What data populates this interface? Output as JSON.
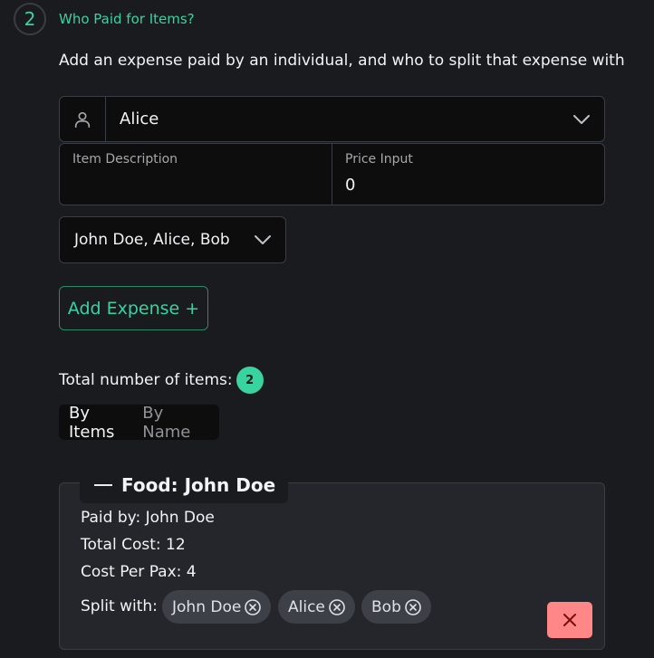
{
  "step": {
    "number": "2",
    "title": "Who Paid for Items?",
    "subtitle": "Add an expense paid by an individual, and who to split that expense with"
  },
  "form": {
    "payer": {
      "icon": "user-icon",
      "value": "Alice"
    },
    "item_description": {
      "label": "Item Description",
      "value": ""
    },
    "price_input": {
      "label": "Price Input",
      "value": "0"
    },
    "split_with": {
      "value": "John Doe, Alice, Bob"
    },
    "add_button": "Add Expense +"
  },
  "summary": {
    "total_label": "Total number of items:",
    "total_count": "2",
    "tabs": [
      {
        "label": "By Items",
        "active": true
      },
      {
        "label": "By Name",
        "active": false
      }
    ]
  },
  "expense_card": {
    "legend": "Food: John Doe",
    "paid_by": "Paid by: John Doe",
    "total_cost": "Total Cost: 12",
    "cost_per_pax": "Cost Per Pax: 4",
    "split_label": "Split with:",
    "split_people": [
      "John Doe",
      "Alice",
      "Bob"
    ]
  },
  "colors": {
    "accent": "#38d39f",
    "background": "#1a1b1e",
    "danger": "#ff8787"
  }
}
